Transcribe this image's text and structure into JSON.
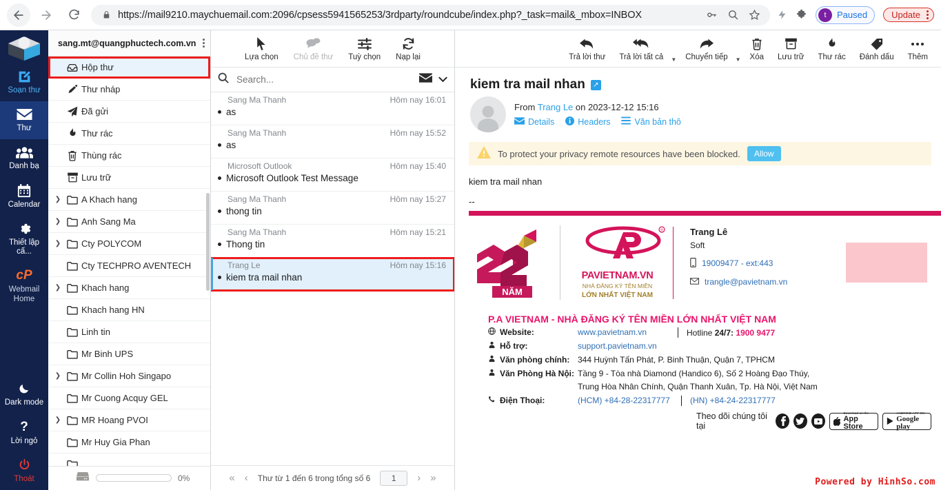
{
  "browser": {
    "url": "https://mail9210.maychuemail.com:2096/cpsess5941565253/3rdparty/roundcube/index.php?_task=mail&_mbox=INBOX",
    "profile_initial": "t",
    "profile_label": "Paused",
    "update_label": "Update",
    "icons": [
      "back-arrow-icon",
      "forward-arrow-icon",
      "reload-icon",
      "lock-icon",
      "key-icon",
      "zoom-out-icon",
      "star-icon",
      "lightning-icon",
      "puzzle-icon"
    ]
  },
  "rail": {
    "items": [
      {
        "label": "Soạn thư",
        "icon": "compose-pencil-icon"
      },
      {
        "label": "Thư",
        "icon": "envelope-icon"
      },
      {
        "label": "Danh bạ",
        "icon": "contacts-icon"
      },
      {
        "label": "Calendar",
        "icon": "calendar-icon"
      },
      {
        "label": "Thiết lập cấ...",
        "icon": "gear-icon"
      },
      {
        "label": "Webmail Home",
        "icon": "cpanel-icon"
      }
    ],
    "bottom": [
      {
        "label": "Dark mode",
        "icon": "moon-icon"
      },
      {
        "label": "Lời ngỏ",
        "icon": "question-mark-icon"
      },
      {
        "label": "Thoát",
        "icon": "power-icon"
      }
    ]
  },
  "folders": {
    "account": "sang.mt@quangphuctech.com.vn",
    "quota_percent": "0%",
    "items": [
      {
        "label": "Hộp thư",
        "icon": "inbox-icon",
        "expandable": false,
        "selected": true,
        "highlight": true
      },
      {
        "label": "Thư nháp",
        "icon": "draft-pencil-icon",
        "expandable": false
      },
      {
        "label": "Đã gửi",
        "icon": "paper-plane-icon",
        "expandable": false
      },
      {
        "label": "Thư rác",
        "icon": "junk-fire-icon",
        "expandable": false
      },
      {
        "label": "Thùng rác",
        "icon": "trash-icon",
        "expandable": false
      },
      {
        "label": "Lưu trữ",
        "icon": "archive-icon",
        "expandable": false
      },
      {
        "label": "A Khach hang",
        "icon": "folder-icon",
        "expandable": true
      },
      {
        "label": "Anh Sang Ma",
        "icon": "folder-icon",
        "expandable": true
      },
      {
        "label": "Cty POLYCOM",
        "icon": "folder-icon",
        "expandable": true
      },
      {
        "label": "Cty TECHPRO AVENTECH",
        "icon": "folder-icon",
        "expandable": false
      },
      {
        "label": "Khach hang",
        "icon": "folder-icon",
        "expandable": true
      },
      {
        "label": "Khach hang HN",
        "icon": "folder-icon",
        "expandable": false
      },
      {
        "label": "Linh tin",
        "icon": "folder-icon",
        "expandable": false
      },
      {
        "label": "Mr Binh UPS",
        "icon": "folder-icon",
        "expandable": false
      },
      {
        "label": "Mr Collin Hoh Singapo",
        "icon": "folder-icon",
        "expandable": true
      },
      {
        "label": "Mr Cuong Acquy GEL",
        "icon": "folder-icon",
        "expandable": false
      },
      {
        "label": "MR Hoang PVOI",
        "icon": "folder-icon",
        "expandable": true
      },
      {
        "label": "Mr Huy Gia Phan",
        "icon": "folder-icon",
        "expandable": false
      }
    ]
  },
  "list_toolbar": {
    "buttons": [
      {
        "label": "Lựa chọn",
        "icon": "cursor-arrow-icon",
        "disabled": false
      },
      {
        "label": "Chủ đề thư",
        "icon": "threads-bubble-icon",
        "disabled": true
      },
      {
        "label": "Tuỳ chọn",
        "icon": "sliders-icon",
        "disabled": false
      },
      {
        "label": "Nạp lại",
        "icon": "refresh-icon",
        "disabled": false
      }
    ]
  },
  "search": {
    "placeholder": "Search...",
    "scope_icon": "envelope-icon",
    "chevron_icon": "chevron-down-icon"
  },
  "messages": [
    {
      "from": "Sang Ma Thanh",
      "date": "Hôm nay 16:01",
      "subject": "as",
      "selected": false
    },
    {
      "from": "Sang Ma Thanh",
      "date": "Hôm nay 15:52",
      "subject": "as",
      "selected": false
    },
    {
      "from": "Microsoft Outlook",
      "date": "Hôm nay 15:40",
      "subject": "Microsoft Outlook Test Message",
      "selected": false
    },
    {
      "from": "Sang Ma Thanh",
      "date": "Hôm nay 15:27",
      "subject": "thong tin",
      "selected": false
    },
    {
      "from": "Sang Ma Thanh",
      "date": "Hôm nay 15:21",
      "subject": "Thong tin",
      "selected": false
    },
    {
      "from": "Trang Le",
      "date": "Hôm nay 15:16",
      "subject": "kiem tra mail nhan",
      "selected": true,
      "highlight": true
    }
  ],
  "pager": {
    "first": "«",
    "prev": "‹",
    "next": "›",
    "last": "»",
    "status": "Thư từ 1 đến 6 trong tổng số 6",
    "page": "1"
  },
  "view_toolbar": {
    "buttons": [
      {
        "label": "Trả lời thư",
        "icon": "reply-icon",
        "caret": false
      },
      {
        "label": "Trả lời tất cả",
        "icon": "reply-all-icon",
        "caret": true
      },
      {
        "label": "Chuyển tiếp",
        "icon": "forward-icon",
        "caret": true
      },
      {
        "label": "Xóa",
        "icon": "trash-icon",
        "caret": false
      },
      {
        "label": "Lưu trữ",
        "icon": "archive-icon",
        "caret": false
      },
      {
        "label": "Thư rác",
        "icon": "junk-fire-icon",
        "caret": false
      },
      {
        "label": "Đánh dấu",
        "icon": "tag-icon",
        "caret": false
      },
      {
        "label": "Thêm",
        "icon": "more-dots-icon",
        "caret": false
      }
    ]
  },
  "message": {
    "subject": "kiem tra mail nhan",
    "from_prefix": "From",
    "from_name": "Trang Le",
    "on_text": "on 2023-12-12 15:16",
    "links": [
      {
        "label": "Details",
        "icon": "envelope-icon"
      },
      {
        "label": "Headers",
        "icon": "info-icon"
      },
      {
        "label": "Văn bản thô",
        "icon": "lines-icon"
      }
    ],
    "warning": {
      "text": "To protect your privacy remote resources have been blocked.",
      "button": "Allow",
      "icon": "warning-triangle-icon"
    },
    "body": "kiem tra mail nhan",
    "dashes": "--"
  },
  "signature": {
    "logo_years": "22",
    "logo_years_sub": "NĂM",
    "brand_word": "PAVIETNAM.VN",
    "brand_sub_1": "NHÀ ĐĂNG KÝ TÊN MIỀN",
    "brand_sub_2": "LỚN NHẤT VIỆT NAM",
    "person_name": "Trang Lê",
    "person_role": "Soft",
    "person_phone": "19009477 - ext:443",
    "person_email": "trangle@pavietnam.vn",
    "title": "P.A VIETNAM - NHÀ ĐĂNG KÝ TÊN MIỀN LỚN NHẤT VIỆT NAM",
    "rows": [
      {
        "label": "Website:",
        "icon": "globe-icon",
        "value": "www.pavietnam.vn",
        "link": true
      },
      {
        "label": "Hỗ trợ:",
        "icon": "support-icon",
        "value": "support.pavietnam.vn",
        "link": true
      },
      {
        "label": "Văn phòng chính:",
        "icon": "person-icon",
        "value": "344 Huỳnh Tấn Phát, P. Binh Thuận, Quận 7, TPHCM",
        "link": false
      },
      {
        "label": "Văn Phòng Hà Nội:",
        "icon": "person-icon",
        "value": "Tầng 9 - Tòa nhà Diamond (Handico 6), Số 2 Hoàng Đạo Thúy,",
        "value2": "Trung Hòa Nhân Chính, Quận Thanh Xuân, Tp. Hà Nội, Việt Nam",
        "link": false
      },
      {
        "label": "Điện Thoại:",
        "icon": "phone-icon",
        "value": "(HCM) +84-28-22317777",
        "value2": "(HN) +84-24-22317777",
        "link": true
      }
    ],
    "hotline_label": "Hotline",
    "hotline_bold": "24/7:",
    "hotline_number": "1900 9477",
    "follow_label": "Theo dõi chúng tôi tại",
    "social": [
      "facebook-icon",
      "twitter-icon",
      "youtube-icon"
    ],
    "appstore_sub": "Download on the",
    "appstore_main": "App Store",
    "googleplay_sub": "ANDROID APP ON",
    "googleplay_main": "Google play"
  },
  "watermark": "Powered by HinhSo.com",
  "colors": {
    "rail_bg": "#12224b",
    "accent_blue": "#2aa1e8",
    "brand_pink": "#d4145a",
    "highlight_red": "#ee1b1b",
    "selected_row": "#e1f0fb"
  }
}
